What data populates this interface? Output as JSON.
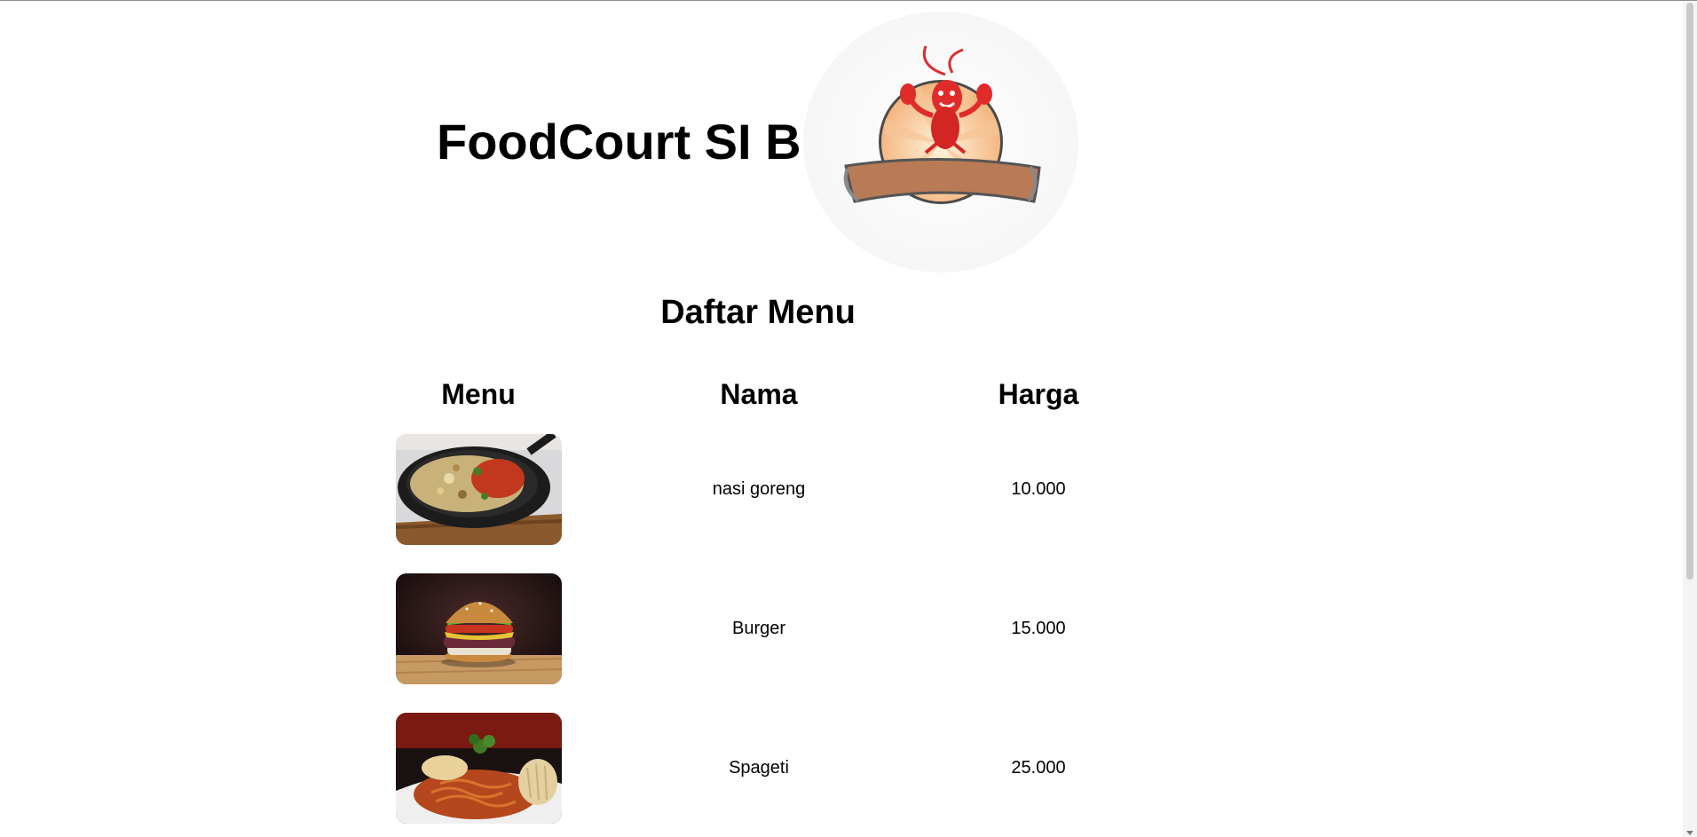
{
  "header": {
    "site_title": "FoodCourt SI B",
    "logo_icon": "lobster-mascot-icon"
  },
  "menu_section": {
    "title": "Daftar Menu",
    "columns": [
      "Menu",
      "Nama",
      "Harga"
    ],
    "items": [
      {
        "image_icon": "fried-rice-photo",
        "nama": "nasi goreng",
        "harga": "10.000"
      },
      {
        "image_icon": "burger-photo",
        "nama": "Burger",
        "harga": "15.000"
      },
      {
        "image_icon": "spaghetti-photo",
        "nama": "Spageti",
        "harga": "25.000"
      }
    ]
  },
  "colors": {
    "text": "#000000",
    "background": "#ffffff",
    "lobster_red": "#e02b2b",
    "banner_brown": "#b97a56"
  }
}
